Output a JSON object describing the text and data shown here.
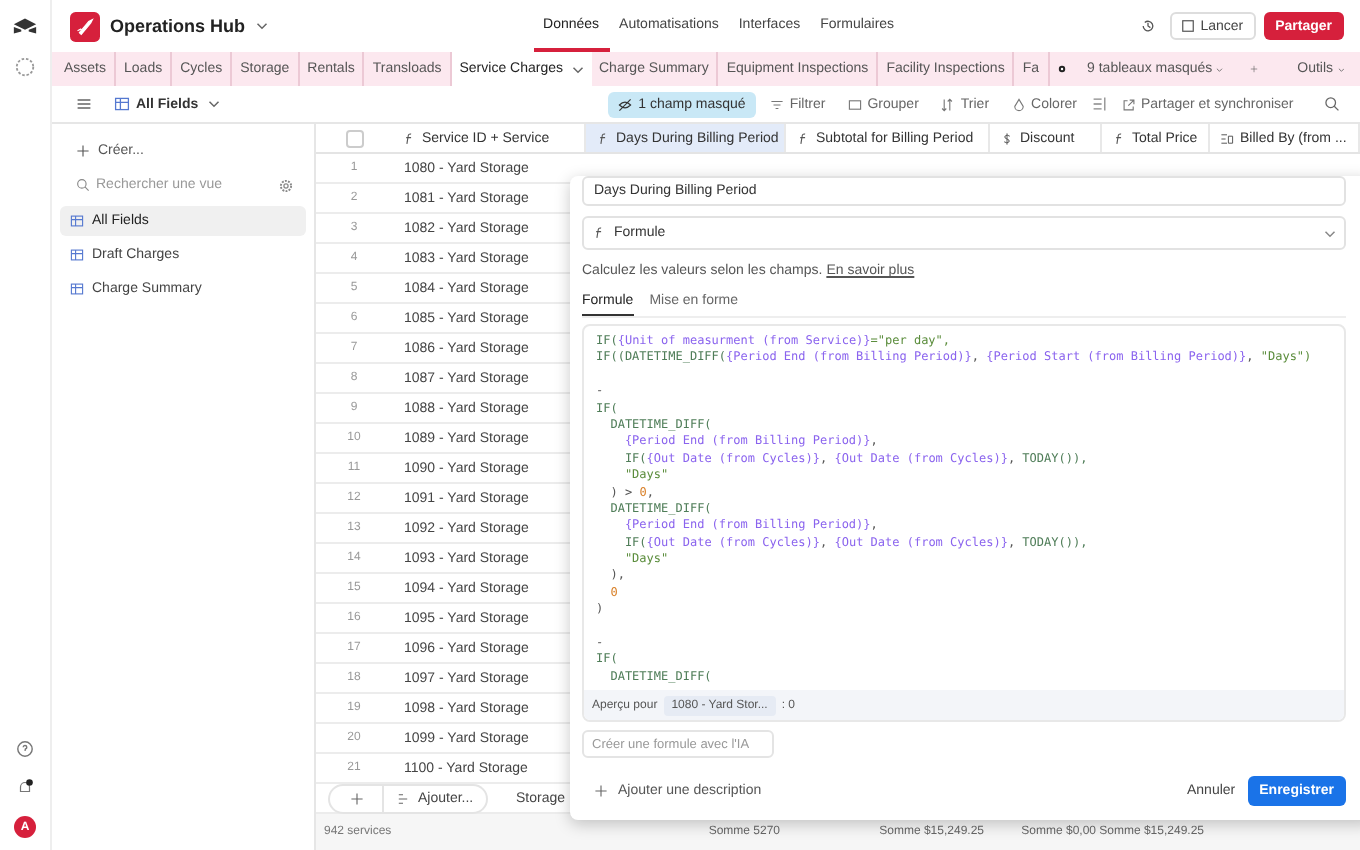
{
  "base": {
    "name": "Operations Hub"
  },
  "rail": {
    "avatar": "A"
  },
  "nav": [
    {
      "label": "Données",
      "selected": true
    },
    {
      "label": "Automatisations",
      "selected": false
    },
    {
      "label": "Interfaces",
      "selected": false
    },
    {
      "label": "Formulaires",
      "selected": false
    }
  ],
  "header_actions": {
    "launch": "Lancer",
    "share": "Partager"
  },
  "tables": [
    {
      "label": "Assets",
      "selected": false
    },
    {
      "label": "Loads",
      "selected": false
    },
    {
      "label": "Cycles",
      "selected": false
    },
    {
      "label": "Storage",
      "selected": false
    },
    {
      "label": "Rentals",
      "selected": false
    },
    {
      "label": "Transloads",
      "selected": false
    },
    {
      "label": "Service Charges",
      "selected": true
    },
    {
      "label": "Charge Summary",
      "selected": false
    },
    {
      "label": "Equipment Inspections",
      "selected": false
    },
    {
      "label": "Facility Inspections",
      "selected": false
    },
    {
      "label": "Fa",
      "selected": false
    }
  ],
  "hidden_tables": "9 tableaux masqués",
  "tools": "Outils",
  "toolbar": {
    "view": "All Fields",
    "hidden_fields": "1 champ masqué",
    "items": [
      {
        "kind": "filter",
        "label": "Filtrer"
      },
      {
        "kind": "group",
        "label": "Grouper"
      },
      {
        "kind": "sort",
        "label": "Trier"
      },
      {
        "kind": "color",
        "label": "Colorer"
      }
    ],
    "sync": "Partager et synchroniser"
  },
  "sidebar": {
    "create": "Créer...",
    "search_placeholder": "Rechercher une vue",
    "views": [
      {
        "label": "All Fields",
        "selected": true
      },
      {
        "label": "Draft Charges",
        "selected": false
      },
      {
        "label": "Charge Summary",
        "selected": false
      }
    ]
  },
  "grid": {
    "select_all_checked": false,
    "columns": [
      {
        "label": "Service ID + Service",
        "kind": "formula",
        "selected": false
      },
      {
        "label": "Days During Billing Period",
        "kind": "formula",
        "selected": true,
        "sum": "Somme 5270"
      },
      {
        "label": "Subtotal for Billing Period",
        "kind": "formula",
        "selected": false,
        "sum": "Somme $15,249.25"
      },
      {
        "label": "Discount",
        "kind": "currency",
        "selected": false,
        "sum": "Somme $0,00"
      },
      {
        "label": "Total Price",
        "kind": "formula",
        "selected": false,
        "sum": "Somme $15,249.25"
      },
      {
        "label": "Billed By (from ...",
        "kind": "lookup",
        "selected": false
      }
    ],
    "rows": [
      {
        "num": "1",
        "service": "1080 - Yard Storage"
      },
      {
        "num": "2",
        "service": "1081 - Yard Storage"
      },
      {
        "num": "3",
        "service": "1082 - Yard Storage"
      },
      {
        "num": "4",
        "service": "1083 - Yard Storage"
      },
      {
        "num": "5",
        "service": "1084 - Yard Storage"
      },
      {
        "num": "6",
        "service": "1085 - Yard Storage"
      },
      {
        "num": "7",
        "service": "1086 - Yard Storage"
      },
      {
        "num": "8",
        "service": "1087 - Yard Storage"
      },
      {
        "num": "9",
        "service": "1088 - Yard Storage"
      },
      {
        "num": "10",
        "service": "1089 - Yard Storage"
      },
      {
        "num": "11",
        "service": "1090 - Yard Storage"
      },
      {
        "num": "12",
        "service": "1091 - Yard Storage"
      },
      {
        "num": "13",
        "service": "1092 - Yard Storage"
      },
      {
        "num": "14",
        "service": "1093 - Yard Storage"
      },
      {
        "num": "15",
        "service": "1094 - Yard Storage"
      },
      {
        "num": "16",
        "service": "1095 - Yard Storage"
      },
      {
        "num": "17",
        "service": "1096 - Yard Storage"
      },
      {
        "num": "18",
        "service": "1097 - Yard Storage"
      },
      {
        "num": "19",
        "service": "1098 - Yard Storage"
      },
      {
        "num": "20",
        "service": "1099 - Yard Storage"
      },
      {
        "num": "21",
        "service": "1100 - Yard Storage"
      }
    ],
    "partial_row": "Storage",
    "add_button": "Ajouter...",
    "record_count": "942 services"
  },
  "field_editor": {
    "name": "Days During Billing Period",
    "type": "Formule",
    "description": "Calculez les valeurs selon les champs.",
    "learn_more": "En savoir plus",
    "tabs": [
      {
        "label": "Formule",
        "selected": true
      },
      {
        "label": "Mise en forme",
        "selected": false
      }
    ],
    "code": [
      {
        "kind": "code",
        "segments": [
          {
            "kind": "fn",
            "text": "IF("
          },
          {
            "kind": "field",
            "text": "{Unit of measurment (from Service)}"
          },
          {
            "kind": "str",
            "text": "=\"per day\","
          }
        ]
      },
      {
        "kind": "code",
        "segments": [
          {
            "kind": "fn",
            "text": "IF((DATETIME_DIFF("
          },
          {
            "kind": "field",
            "text": "{Period End (from Billing Period)}"
          },
          {
            "kind": "plain",
            "text": ", "
          },
          {
            "kind": "field",
            "text": "{Period Start (from Billing Period)}"
          },
          {
            "kind": "plain",
            "text": ", "
          },
          {
            "kind": "str",
            "text": "\"Days\")"
          }
        ]
      },
      {
        "kind": "blank"
      },
      {
        "kind": "code",
        "segments": [
          {
            "kind": "plain",
            "text": "-"
          }
        ]
      },
      {
        "kind": "code",
        "segments": [
          {
            "kind": "fn",
            "text": "IF("
          }
        ]
      },
      {
        "kind": "code",
        "segments": [
          {
            "kind": "fn",
            "text": "  DATETIME_DIFF("
          }
        ]
      },
      {
        "kind": "code",
        "segments": [
          {
            "kind": "field",
            "text": "    {Period End (from Billing Period)}"
          },
          {
            "kind": "plain",
            "text": ","
          }
        ]
      },
      {
        "kind": "code",
        "segments": [
          {
            "kind": "fn",
            "text": "    IF("
          },
          {
            "kind": "field",
            "text": "{Out Date (from Cycles)}"
          },
          {
            "kind": "plain",
            "text": ", "
          },
          {
            "kind": "field",
            "text": "{Out Date (from Cycles)}"
          },
          {
            "kind": "plain",
            "text": ", "
          },
          {
            "kind": "fn",
            "text": "TODAY()),"
          }
        ]
      },
      {
        "kind": "code",
        "segments": [
          {
            "kind": "str",
            "text": "    \"Days\""
          }
        ]
      },
      {
        "kind": "code",
        "segments": [
          {
            "kind": "plain",
            "text": "  ) > "
          },
          {
            "kind": "num",
            "text": "0"
          },
          {
            "kind": "plain",
            "text": ","
          }
        ]
      },
      {
        "kind": "code",
        "segments": [
          {
            "kind": "fn",
            "text": "  DATETIME_DIFF("
          }
        ]
      },
      {
        "kind": "code",
        "segments": [
          {
            "kind": "field",
            "text": "    {Period End (from Billing Period)}"
          },
          {
            "kind": "plain",
            "text": ","
          }
        ]
      },
      {
        "kind": "code",
        "segments": [
          {
            "kind": "fn",
            "text": "    IF("
          },
          {
            "kind": "field",
            "text": "{Out Date (from Cycles)}"
          },
          {
            "kind": "plain",
            "text": ", "
          },
          {
            "kind": "field",
            "text": "{Out Date (from Cycles)}"
          },
          {
            "kind": "plain",
            "text": ", "
          },
          {
            "kind": "fn",
            "text": "TODAY()),"
          }
        ]
      },
      {
        "kind": "code",
        "segments": [
          {
            "kind": "str",
            "text": "    \"Days\""
          }
        ]
      },
      {
        "kind": "code",
        "segments": [
          {
            "kind": "plain",
            "text": "  ),"
          }
        ]
      },
      {
        "kind": "code",
        "segments": [
          {
            "kind": "num",
            "text": "  0"
          }
        ]
      },
      {
        "kind": "code",
        "segments": [
          {
            "kind": "plain",
            "text": ")"
          }
        ]
      },
      {
        "kind": "blank"
      },
      {
        "kind": "code",
        "segments": [
          {
            "kind": "plain",
            "text": "-"
          }
        ]
      },
      {
        "kind": "code",
        "segments": [
          {
            "kind": "fn",
            "text": "IF("
          }
        ]
      },
      {
        "kind": "code",
        "segments": [
          {
            "kind": "fn",
            "text": "  DATETIME_DIFF("
          }
        ]
      }
    ],
    "preview_label": "Aperçu pour",
    "preview_record": "1080 - Yard Stor...",
    "preview_value": ": 0",
    "ai_placeholder": "Créer une formule avec l'IA",
    "add_description": "Ajouter une description",
    "cancel": "Annuler",
    "save": "Enregistrer"
  }
}
